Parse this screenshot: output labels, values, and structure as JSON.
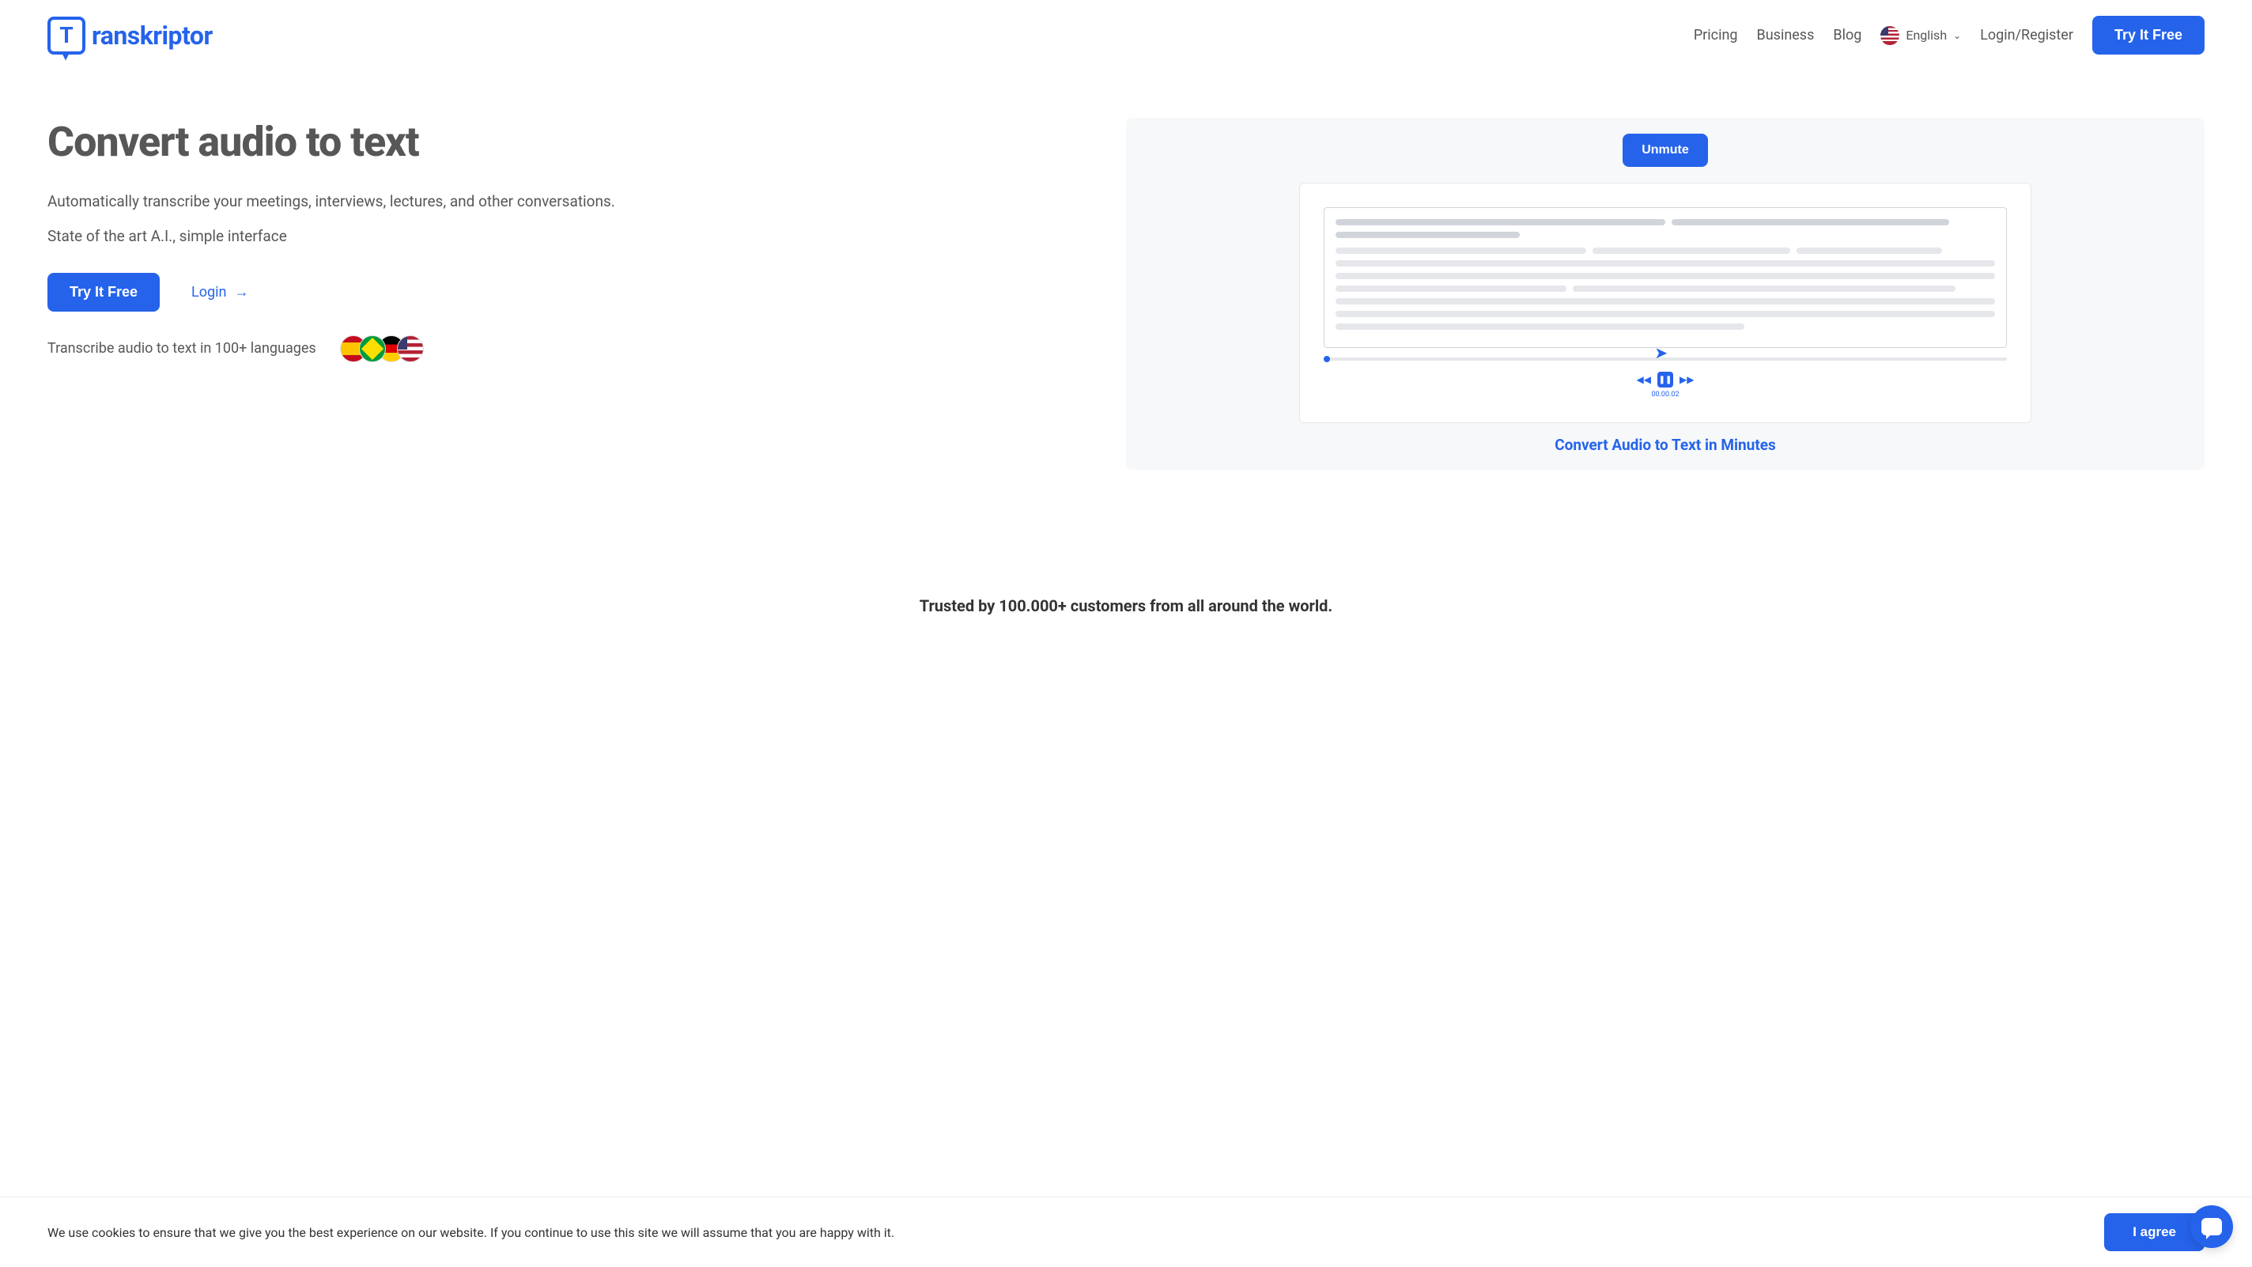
{
  "logo": {
    "letter": "T",
    "brand": "ranskriptor"
  },
  "nav": {
    "pricing": "Pricing",
    "business": "Business",
    "blog": "Blog",
    "language": "English",
    "login": "Login/Register",
    "cta": "Try It Free"
  },
  "hero": {
    "title": "Convert audio to text",
    "desc1": "Automatically transcribe your meetings, interviews, lectures, and other conversations.",
    "desc2": "State of the art A.I., simple interface",
    "cta": "Try It Free",
    "login": "Login",
    "lang_text": "Transcribe audio to text in 100+ languages"
  },
  "preview": {
    "unmute": "Unmute",
    "time": "00.00.02",
    "caption": "Convert Audio to Text in Minutes"
  },
  "trusted": "Trusted by 100.000+ customers from all around the world.",
  "cookie": {
    "text": "We use cookies to ensure that we give you the best experience on our website. If you continue to use this site we will assume that you are happy with it.",
    "agree": "I agree"
  }
}
